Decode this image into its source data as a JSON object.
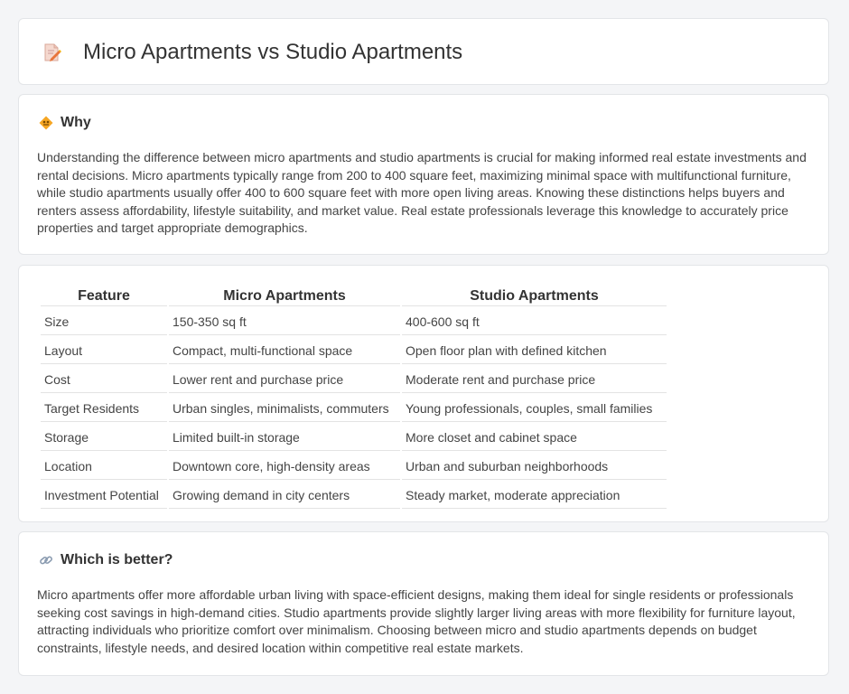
{
  "header": {
    "title": "Micro Apartments vs Studio Apartments",
    "icon": "document-pencil-icon"
  },
  "why": {
    "title": "Why",
    "icon": "diamond-sign-icon",
    "text": "Understanding the difference between micro apartments and studio apartments is crucial for making informed real estate investments and rental decisions. Micro apartments typically range from 200 to 400 square feet, maximizing minimal space with multifunctional furniture, while studio apartments usually offer 400 to 600 square feet with more open living areas. Knowing these distinctions helps buyers and renters assess affordability, lifestyle suitability, and market value. Real estate professionals leverage this knowledge to accurately price properties and target appropriate demographics."
  },
  "table": {
    "headers": [
      "Feature",
      "Micro Apartments",
      "Studio Apartments"
    ],
    "rows": [
      [
        "Size",
        "150-350 sq ft",
        "400-600 sq ft"
      ],
      [
        "Layout",
        "Compact, multi-functional space",
        "Open floor plan with defined kitchen"
      ],
      [
        "Cost",
        "Lower rent and purchase price",
        "Moderate rent and purchase price"
      ],
      [
        "Target Residents",
        "Urban singles, minimalists, commuters",
        "Young professionals, couples, small families"
      ],
      [
        "Storage",
        "Limited built-in storage",
        "More closet and cabinet space"
      ],
      [
        "Location",
        "Downtown core, high-density areas",
        "Urban and suburban neighborhoods"
      ],
      [
        "Investment Potential",
        "Growing demand in city centers",
        "Steady market, moderate appreciation"
      ]
    ]
  },
  "better": {
    "title": "Which is better?",
    "icon": "link-icon",
    "text": "Micro apartments offer more affordable urban living with space-efficient designs, making them ideal for single residents or professionals seeking cost savings in high-demand cities. Studio apartments provide slightly larger living areas with more flexibility for furniture layout, attracting individuals who prioritize comfort over minimalism. Choosing between micro and studio apartments depends on budget constraints, lifestyle needs, and desired location within competitive real estate markets."
  }
}
